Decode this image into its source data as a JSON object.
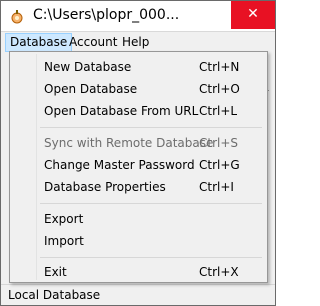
{
  "window": {
    "title": "C:\\Users\\plopr_000...",
    "close_symbol": "✕",
    "icon": "app-icon"
  },
  "menubar": {
    "items": [
      {
        "label": "Database",
        "active": true
      },
      {
        "label": "Account",
        "active": false
      },
      {
        "label": "Help",
        "active": false
      }
    ]
  },
  "dropdown": {
    "items": [
      {
        "label": "New Database",
        "shortcut": "Ctrl+N",
        "enabled": true
      },
      {
        "label": "Open Database",
        "shortcut": "Ctrl+O",
        "enabled": true
      },
      {
        "label": "Open Database From URL",
        "shortcut": "Ctrl+L",
        "enabled": true
      },
      {
        "label": "Sync with Remote Database",
        "shortcut": "Ctrl+S",
        "enabled": false
      },
      {
        "label": "Change Master Password",
        "shortcut": "Ctrl+G",
        "enabled": true
      },
      {
        "label": "Database Properties",
        "shortcut": "Ctrl+I",
        "enabled": true
      },
      {
        "label": "Export",
        "shortcut": "",
        "enabled": true
      },
      {
        "label": "Import",
        "shortcut": "",
        "enabled": true
      },
      {
        "label": "Exit",
        "shortcut": "Ctrl+X",
        "enabled": true
      }
    ]
  },
  "statusbar": {
    "text": "Local Database"
  },
  "colors": {
    "close_button": "#e81123",
    "menu_highlight": "#cde8ff",
    "disabled_text": "#6d6d6d"
  }
}
